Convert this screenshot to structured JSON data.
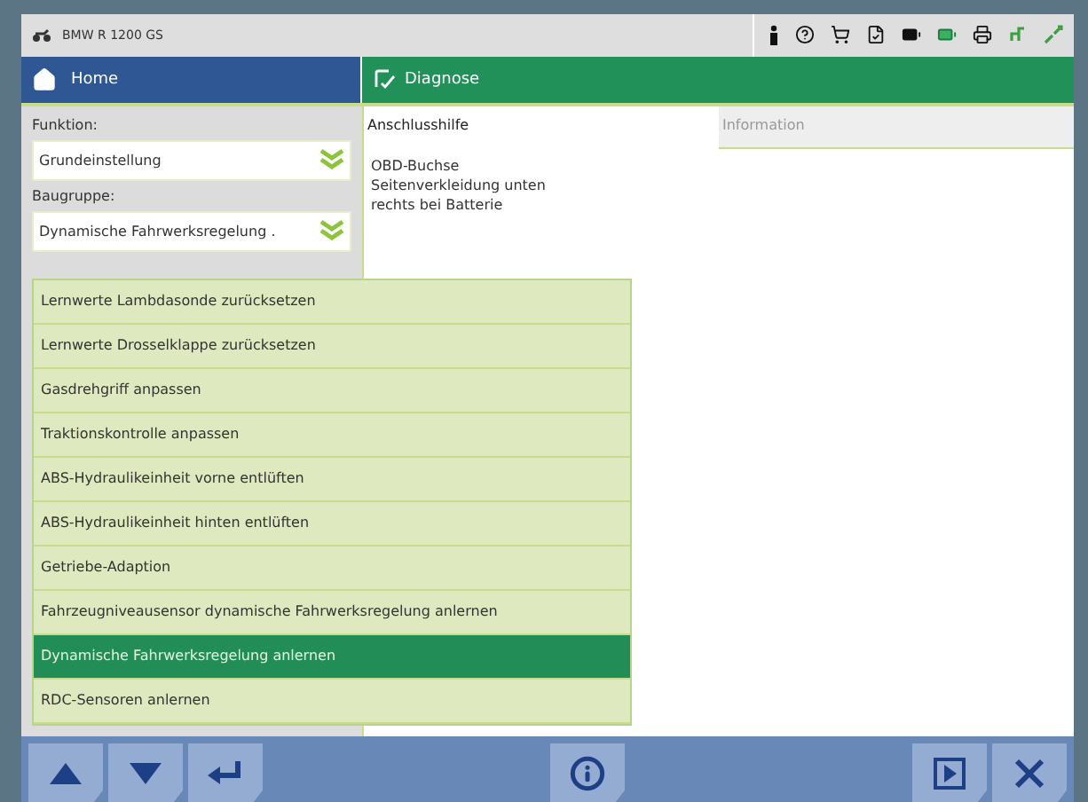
{
  "title_bar": {
    "vehicle": "BMW R 1200 GS"
  },
  "header": {
    "home": "Home",
    "section": "Diagnose"
  },
  "left_panel": {
    "function_label": "Funktion:",
    "function_value": "Grundeinstellung",
    "group_label": "Baugruppe:",
    "group_value": "Dynamische Fahrwerksregelung ."
  },
  "dropdown": {
    "items": [
      {
        "label": "Lernwerte Lambdasonde zurücksetzen",
        "selected": false
      },
      {
        "label": "Lernwerte Drosselklappe zurücksetzen",
        "selected": false
      },
      {
        "label": "Gasdrehgriff anpassen",
        "selected": false
      },
      {
        "label": "Traktionskontrolle anpassen",
        "selected": false
      },
      {
        "label": "ABS-Hydraulikeinheit vorne entlüften",
        "selected": false
      },
      {
        "label": "ABS-Hydraulikeinheit hinten entlüften",
        "selected": false
      },
      {
        "label": "Getriebe-Adaption",
        "selected": false
      },
      {
        "label": "Fahrzeugniveausensor dynamische Fahrwerksregelung anlernen",
        "selected": false
      },
      {
        "label": "Dynamische Fahrwerksregelung anlernen",
        "selected": true
      },
      {
        "label": "RDC-Sensoren anlernen",
        "selected": false
      }
    ]
  },
  "right_panel": {
    "tabs": [
      {
        "label": "Anschlusshilfe",
        "selected": true
      },
      {
        "label": "Information",
        "selected": false
      }
    ],
    "lines": [
      "OBD-Buchse",
      "Seitenverkleidung unten",
      "rechts bei Batterie"
    ]
  }
}
